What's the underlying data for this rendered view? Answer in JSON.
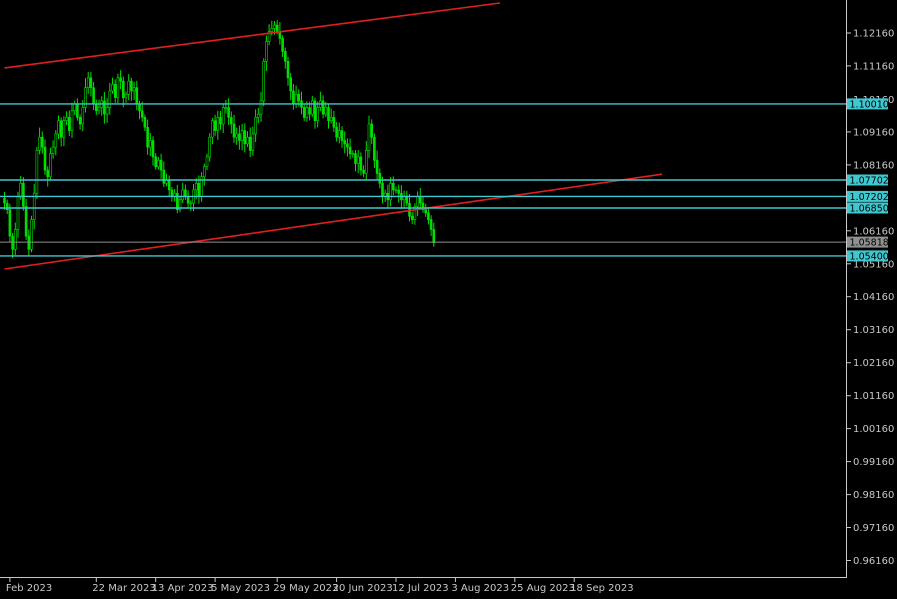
{
  "chart_data": {
    "type": "candlestick",
    "instrument_hint": "daily price chart",
    "colors": {
      "background": "#000000",
      "candles": "#00e000",
      "axis": "#c8c8c8",
      "trendlines": "#e02020",
      "levels": "#40c8d0",
      "current_price": "#909090"
    },
    "grid": false,
    "ylim": [
      0.9566,
      1.1316
    ],
    "y_ticks": [
      "1.12160",
      "1.11160",
      "1.09160",
      "1.08160",
      "1.06160",
      "1.05160",
      "1.04160",
      "1.03160",
      "1.02160",
      "1.01160",
      "1.00160",
      "0.99160",
      "0.98160",
      "0.97160",
      "0.96160"
    ],
    "x_labels": [
      "Feb 2023",
      "22 Mar 2023",
      "13 Apr 2023",
      "5 May 2023",
      "29 May 2023",
      "20 Jun 2023",
      "12 Jul 2023",
      "3 Aug 2023",
      "25 Aug 2023",
      "18 Sep 2023"
    ],
    "x_label_bars": [
      2,
      34,
      56,
      78,
      101,
      123,
      145,
      167,
      189,
      211
    ],
    "total_bars": 218,
    "closes": [
      1.07,
      1.068,
      1.06,
      1.056,
      1.062,
      1.072,
      1.076,
      1.069,
      1.06,
      1.056,
      1.065,
      1.073,
      1.086,
      1.09,
      1.087,
      1.08,
      1.078,
      1.085,
      1.087,
      1.091,
      1.095,
      1.09,
      1.095,
      1.096,
      1.092,
      1.098,
      1.1,
      1.096,
      1.094,
      1.099,
      1.105,
      1.108,
      1.105,
      1.1,
      1.098,
      1.099,
      1.101,
      1.097,
      1.099,
      1.104,
      1.106,
      1.102,
      1.108,
      1.107,
      1.102,
      1.103,
      1.107,
      1.104,
      1.105,
      1.1,
      1.098,
      1.096,
      1.093,
      1.087,
      1.089,
      1.084,
      1.081,
      1.083,
      1.08,
      1.076,
      1.077,
      1.074,
      1.072,
      1.073,
      1.068,
      1.071,
      1.074,
      1.072,
      1.07,
      1.07,
      1.074,
      1.076,
      1.072,
      1.078,
      1.081,
      1.084,
      1.09,
      1.095,
      1.092,
      1.096,
      1.094,
      1.099,
      1.099,
      1.096,
      1.094,
      1.09,
      1.091,
      1.089,
      1.092,
      1.088,
      1.09,
      1.086,
      1.091,
      1.096,
      1.097,
      1.101,
      1.113,
      1.119,
      1.122,
      1.123,
      1.124,
      1.122,
      1.12,
      1.116,
      1.113,
      1.108,
      1.104,
      1.1,
      1.103,
      1.101,
      1.099,
      1.096,
      1.099,
      1.097,
      1.101,
      1.095,
      1.099,
      1.101,
      1.097,
      1.099,
      1.095,
      1.096,
      1.093,
      1.09,
      1.092,
      1.089,
      1.088,
      1.087,
      1.085,
      1.085,
      1.082,
      1.084,
      1.08,
      1.079,
      1.086,
      1.094,
      1.09,
      1.083,
      1.079,
      1.076,
      1.072,
      1.073,
      1.071,
      1.076,
      1.074,
      1.074,
      1.073,
      1.071,
      1.072,
      1.07,
      1.066,
      1.065,
      1.069,
      1.072,
      1.07,
      1.068,
      1.067,
      1.065,
      1.062,
      1.058
    ],
    "trendlines": [
      {
        "name": "upper channel line",
        "points": [
          [
            0,
            1.111
          ],
          [
            205,
            1.133
          ]
        ]
      },
      {
        "name": "lower channel line",
        "points": [
          [
            0,
            1.05
          ],
          [
            330,
            1.089
          ]
        ]
      }
    ],
    "levels": [
      {
        "value": 1.1001,
        "label": "1.10010",
        "tick_behind": "1.10160"
      },
      {
        "value": 1.07702,
        "label": "1.07702"
      },
      {
        "value": 1.07202,
        "label": "1.07202"
      },
      {
        "value": 1.0685,
        "label": "1.06850"
      },
      {
        "value": 1.054,
        "label": "1.05400"
      }
    ],
    "current_price": {
      "value": 1.05818,
      "label": "1.05818"
    }
  }
}
